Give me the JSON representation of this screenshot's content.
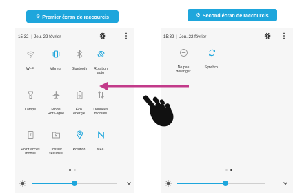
{
  "screen1": {
    "title": "Premier écran de raccourcis",
    "time": "15:32",
    "date": "Jeu. 22 février",
    "tiles": [
      {
        "label": "Wi-Fi",
        "icon": "wifi-icon",
        "active": false
      },
      {
        "label": "Vibreur",
        "icon": "vibrate-icon",
        "active": true
      },
      {
        "label": "Bluetooth",
        "icon": "bluetooth-icon",
        "active": false
      },
      {
        "label": "Rotation\nauto",
        "icon": "rotation-icon",
        "active": true
      },
      {
        "label": "Lampe",
        "icon": "flashlight-icon",
        "active": false
      },
      {
        "label": "Mode\nHors-ligne",
        "icon": "airplane-icon",
        "active": false
      },
      {
        "label": "Éco.\nénergie",
        "icon": "power-saving-icon",
        "active": false
      },
      {
        "label": "Données\nmobiles",
        "icon": "mobile-data-icon",
        "active": false
      },
      {
        "label": "Point accès\nmobile",
        "icon": "hotspot-icon",
        "active": false
      },
      {
        "label": "Dossier\nsécurisé",
        "icon": "secure-folder-icon",
        "active": false
      },
      {
        "label": "Position",
        "icon": "location-icon",
        "active": true
      },
      {
        "label": "NFC",
        "icon": "nfc-icon",
        "active": true
      }
    ],
    "page_indicator": {
      "current": 1,
      "total": 2
    },
    "brightness": 0.5
  },
  "screen2": {
    "title": "Second écran de raccourcis",
    "time": "15:32",
    "date": "Jeu. 22 février",
    "tiles": [
      {
        "label": "Ne pas\ndéranger",
        "icon": "do-not-disturb-icon",
        "active": false
      },
      {
        "label": "Synchro.",
        "icon": "sync-icon",
        "active": true
      }
    ],
    "page_indicator": {
      "current": 2,
      "total": 2
    },
    "brightness": 0.55
  },
  "colors": {
    "accent": "#1ea6dc",
    "inactive_icon": "#9a9a9a",
    "arrow": "#c23a8a",
    "panel": "#f6f6f6"
  }
}
